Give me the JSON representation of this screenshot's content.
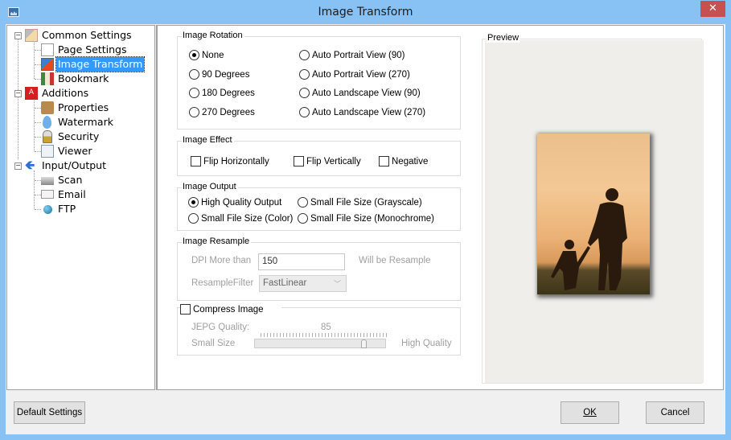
{
  "window": {
    "title": "Image Transform",
    "close_glyph": "✕"
  },
  "tree": {
    "items": [
      {
        "label": "Common Settings",
        "icon": "settings-icon",
        "level": 0,
        "expanded": true
      },
      {
        "label": "Page Settings",
        "icon": "page-settings-icon",
        "level": 1
      },
      {
        "label": "Image Transform",
        "icon": "image-transform-icon",
        "level": 1,
        "selected": true
      },
      {
        "label": "Bookmark",
        "icon": "bookmark-icon",
        "level": 1
      },
      {
        "label": "Additions",
        "icon": "pdf-icon",
        "level": 0,
        "expanded": true
      },
      {
        "label": "Properties",
        "icon": "properties-icon",
        "level": 1
      },
      {
        "label": "Watermark",
        "icon": "watermark-icon",
        "level": 1
      },
      {
        "label": "Security",
        "icon": "lock-icon",
        "level": 1
      },
      {
        "label": "Viewer",
        "icon": "magnifier-icon",
        "level": 1
      },
      {
        "label": "Input/Output",
        "icon": "arrow-left-icon",
        "level": 0,
        "expanded": true
      },
      {
        "label": "Scan",
        "icon": "scanner-icon",
        "level": 1
      },
      {
        "label": "Email",
        "icon": "envelope-icon",
        "level": 1
      },
      {
        "label": "FTP",
        "icon": "globe-icon",
        "level": 1
      }
    ]
  },
  "rotation": {
    "legend": "Image Rotation",
    "options": [
      "None",
      "90 Degrees",
      "180 Degrees",
      "270 Degrees",
      "Auto Portrait View (90)",
      "Auto Portrait View (270)",
      "Auto Landscape View (90)",
      "Auto Landscape View (270)"
    ],
    "selected": "None"
  },
  "effect": {
    "legend": "Image Effect",
    "options": [
      {
        "label": "Flip Horizontally",
        "checked": false
      },
      {
        "label": "Flip Vertically",
        "checked": false
      },
      {
        "label": "Negative",
        "checked": false
      }
    ]
  },
  "output": {
    "legend": "Image Output",
    "options": [
      "High Quality Output",
      "Small File Size (Grayscale)",
      "Small File Size (Color)",
      "Small File Size (Monochrome)"
    ],
    "selected": "High Quality Output"
  },
  "resample": {
    "legend": "Image Resample",
    "dpi_label": "DPI More than",
    "dpi_value": "150",
    "dpi_suffix": "Will be Resample",
    "filter_label": "ResampleFilter",
    "filter_value": "FastLinear"
  },
  "compress": {
    "label": "Compress Image",
    "checked": false,
    "quality_label": "JEPG Quality:",
    "quality_value": "85",
    "min_label": "Small Size",
    "max_label": "High Quality",
    "slider_percent": 85
  },
  "preview": {
    "legend": "Preview"
  },
  "footer": {
    "default_label": "Default Settings",
    "ok_label": "OK",
    "cancel_label": "Cancel"
  }
}
